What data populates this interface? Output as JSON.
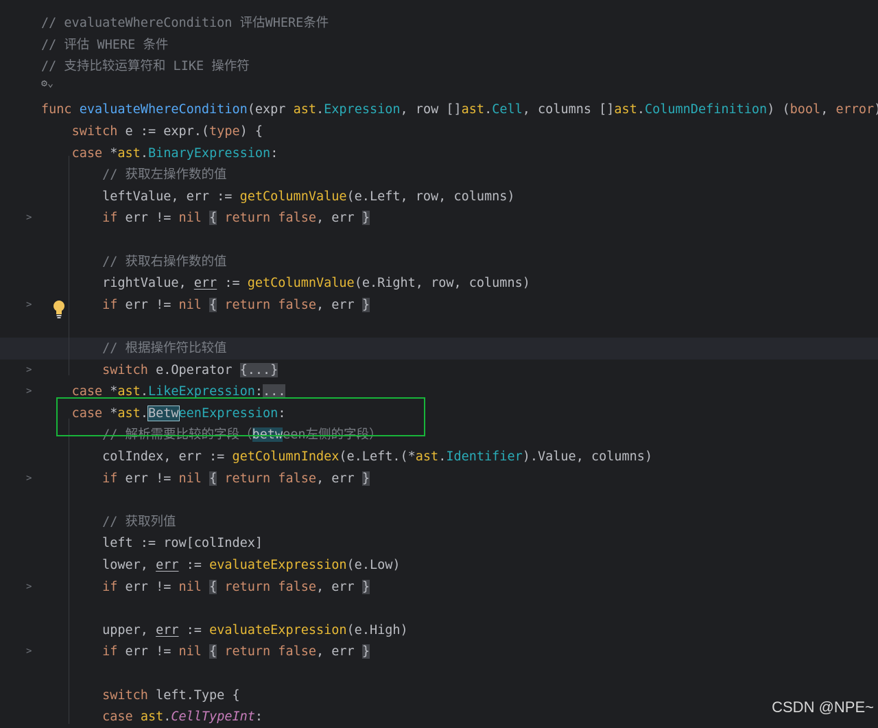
{
  "lines": [
    {
      "fold": false,
      "current": false,
      "tokens": [
        [
          "cmt",
          "// evaluateWhereCondition 评估WHERE条件"
        ]
      ]
    },
    {
      "fold": false,
      "current": false,
      "tokens": [
        [
          "cmt",
          "// 评估 WHERE 条件"
        ]
      ]
    },
    {
      "fold": false,
      "current": false,
      "tokens": [
        [
          "cmt",
          "// 支持比较运算符和 LIKE 操作符"
        ]
      ]
    },
    {
      "fold": false,
      "current": false,
      "tokens": []
    },
    {
      "fold": false,
      "current": false,
      "tokens": [
        [
          "kw",
          "func "
        ],
        [
          "fn",
          "evaluateWhereCondition"
        ],
        [
          "pl",
          "(expr "
        ],
        [
          "call",
          "ast"
        ],
        [
          "pl",
          "."
        ],
        [
          "typ",
          "Expression"
        ],
        [
          "pl",
          ", row []"
        ],
        [
          "call",
          "ast"
        ],
        [
          "pl",
          "."
        ],
        [
          "typ",
          "Cell"
        ],
        [
          "pl",
          ", columns []"
        ],
        [
          "call",
          "ast"
        ],
        [
          "pl",
          "."
        ],
        [
          "typ",
          "ColumnDefinition"
        ],
        [
          "pl",
          ") ("
        ],
        [
          "kw",
          "bool"
        ],
        [
          "pl",
          ", "
        ],
        [
          "kw",
          "error"
        ],
        [
          "pl",
          ")"
        ]
      ]
    },
    {
      "fold": false,
      "current": false,
      "tokens": [
        [
          "pl",
          "    "
        ],
        [
          "kw",
          "switch"
        ],
        [
          "pl",
          " e := expr.("
        ],
        [
          "kw",
          "type"
        ],
        [
          "pl",
          ") {"
        ]
      ]
    },
    {
      "fold": false,
      "current": false,
      "tokens": [
        [
          "pl",
          "    "
        ],
        [
          "kw",
          "case"
        ],
        [
          "pl",
          " *"
        ],
        [
          "call",
          "ast"
        ],
        [
          "pl",
          "."
        ],
        [
          "typ",
          "BinaryExpression"
        ],
        [
          "pl",
          ":"
        ]
      ]
    },
    {
      "fold": false,
      "current": false,
      "tokens": [
        [
          "pl",
          "        "
        ],
        [
          "cmt",
          "// 获取左操作数的值"
        ]
      ]
    },
    {
      "fold": false,
      "current": false,
      "tokens": [
        [
          "pl",
          "        leftValue, err := "
        ],
        [
          "call",
          "getColumnValue"
        ],
        [
          "pl",
          "(e.Left, row, columns)"
        ]
      ]
    },
    {
      "fold": true,
      "current": false,
      "tokens": [
        [
          "pl",
          "        "
        ],
        [
          "kw",
          "if"
        ],
        [
          "pl",
          " err != "
        ],
        [
          "kw",
          "nil"
        ],
        [
          "pl",
          " "
        ],
        [
          "brk",
          "{"
        ],
        [
          "pl",
          " "
        ],
        [
          "kw",
          "return false"
        ],
        [
          "pl",
          ", err "
        ],
        [
          "brk",
          "}"
        ]
      ]
    },
    {
      "fold": false,
      "current": false,
      "tokens": []
    },
    {
      "fold": false,
      "current": false,
      "tokens": [
        [
          "pl",
          "        "
        ],
        [
          "cmt",
          "// 获取右操作数的值"
        ]
      ]
    },
    {
      "fold": false,
      "current": false,
      "tokens": [
        [
          "pl",
          "        rightValue, "
        ],
        [
          "ul",
          "err"
        ],
        [
          "pl",
          " := "
        ],
        [
          "call",
          "getColumnValue"
        ],
        [
          "pl",
          "(e.Right, row, columns)"
        ]
      ]
    },
    {
      "fold": true,
      "current": false,
      "tokens": [
        [
          "pl",
          "        "
        ],
        [
          "kw",
          "if"
        ],
        [
          "pl",
          " err != "
        ],
        [
          "kw",
          "nil"
        ],
        [
          "pl",
          " "
        ],
        [
          "brk",
          "{"
        ],
        [
          "pl",
          " "
        ],
        [
          "kw",
          "return false"
        ],
        [
          "pl",
          ", err "
        ],
        [
          "brk",
          "}"
        ]
      ]
    },
    {
      "fold": false,
      "current": false,
      "tokens": []
    },
    {
      "fold": false,
      "current": true,
      "tokens": [
        [
          "pl",
          "        "
        ],
        [
          "cmt",
          "// 根据操作符比较值"
        ]
      ]
    },
    {
      "fold": true,
      "current": false,
      "tokens": [
        [
          "pl",
          "        "
        ],
        [
          "kw",
          "switch"
        ],
        [
          "pl",
          " e.Operator "
        ],
        [
          "brk",
          "{...}"
        ]
      ]
    },
    {
      "fold": true,
      "current": false,
      "tokens": [
        [
          "pl",
          "    "
        ],
        [
          "kw",
          "case"
        ],
        [
          "pl",
          " *"
        ],
        [
          "call",
          "ast"
        ],
        [
          "pl",
          "."
        ],
        [
          "typ",
          "LikeExpression"
        ],
        [
          "pl",
          ":"
        ],
        [
          "brk",
          "..."
        ]
      ]
    },
    {
      "fold": false,
      "current": false,
      "tokens": [
        [
          "pl",
          "    "
        ],
        [
          "kw",
          "case"
        ],
        [
          "pl",
          " *"
        ],
        [
          "call",
          "ast"
        ],
        [
          "pl",
          "."
        ],
        [
          "hlb",
          "Betw"
        ],
        [
          "typ",
          "eenExpression"
        ],
        [
          "pl",
          ":"
        ]
      ]
    },
    {
      "fold": false,
      "current": false,
      "tokens": [
        [
          "pl",
          "        "
        ],
        [
          "cmt",
          "// 解析需要比较的字段（"
        ],
        [
          "hl",
          "betw"
        ],
        [
          "cmt",
          "een左侧的字段）"
        ]
      ]
    },
    {
      "fold": false,
      "current": false,
      "tokens": [
        [
          "pl",
          "        colIndex, err := "
        ],
        [
          "call",
          "getColumnIndex"
        ],
        [
          "pl",
          "(e.Left.(*"
        ],
        [
          "call",
          "ast"
        ],
        [
          "pl",
          "."
        ],
        [
          "typ",
          "Identifier"
        ],
        [
          "pl",
          ").Value, columns)"
        ]
      ]
    },
    {
      "fold": true,
      "current": false,
      "tokens": [
        [
          "pl",
          "        "
        ],
        [
          "kw",
          "if"
        ],
        [
          "pl",
          " err != "
        ],
        [
          "kw",
          "nil"
        ],
        [
          "pl",
          " "
        ],
        [
          "brk",
          "{"
        ],
        [
          "pl",
          " "
        ],
        [
          "kw",
          "return false"
        ],
        [
          "pl",
          ", err "
        ],
        [
          "brk",
          "}"
        ]
      ]
    },
    {
      "fold": false,
      "current": false,
      "tokens": []
    },
    {
      "fold": false,
      "current": false,
      "tokens": [
        [
          "pl",
          "        "
        ],
        [
          "cmt",
          "// 获取列值"
        ]
      ]
    },
    {
      "fold": false,
      "current": false,
      "tokens": [
        [
          "pl",
          "        left := row[colIndex]"
        ]
      ]
    },
    {
      "fold": false,
      "current": false,
      "tokens": [
        [
          "pl",
          "        lower, "
        ],
        [
          "ul",
          "err"
        ],
        [
          "pl",
          " := "
        ],
        [
          "call",
          "evaluateExpression"
        ],
        [
          "pl",
          "(e.Low)"
        ]
      ]
    },
    {
      "fold": true,
      "current": false,
      "tokens": [
        [
          "pl",
          "        "
        ],
        [
          "kw",
          "if"
        ],
        [
          "pl",
          " err != "
        ],
        [
          "kw",
          "nil"
        ],
        [
          "pl",
          " "
        ],
        [
          "brk",
          "{"
        ],
        [
          "pl",
          " "
        ],
        [
          "kw",
          "return false"
        ],
        [
          "pl",
          ", err "
        ],
        [
          "brk",
          "}"
        ]
      ]
    },
    {
      "fold": false,
      "current": false,
      "tokens": []
    },
    {
      "fold": false,
      "current": false,
      "tokens": [
        [
          "pl",
          "        upper, "
        ],
        [
          "ul",
          "err"
        ],
        [
          "pl",
          " := "
        ],
        [
          "call",
          "evaluateExpression"
        ],
        [
          "pl",
          "(e.High)"
        ]
      ]
    },
    {
      "fold": true,
      "current": false,
      "tokens": [
        [
          "pl",
          "        "
        ],
        [
          "kw",
          "if"
        ],
        [
          "pl",
          " err != "
        ],
        [
          "kw",
          "nil"
        ],
        [
          "pl",
          " "
        ],
        [
          "brk",
          "{"
        ],
        [
          "pl",
          " "
        ],
        [
          "kw",
          "return false"
        ],
        [
          "pl",
          ", err "
        ],
        [
          "brk",
          "}"
        ]
      ]
    },
    {
      "fold": false,
      "current": false,
      "tokens": []
    },
    {
      "fold": false,
      "current": false,
      "tokens": [
        [
          "pl",
          "        "
        ],
        [
          "kw",
          "switch"
        ],
        [
          "pl",
          " left.Type {"
        ]
      ]
    },
    {
      "fold": false,
      "current": false,
      "tokens": [
        [
          "pl",
          "        "
        ],
        [
          "kw",
          "case"
        ],
        [
          "pl",
          " "
        ],
        [
          "call",
          "ast"
        ],
        [
          "pl",
          "."
        ],
        [
          "ityp",
          "CellTypeInt"
        ],
        [
          "pl",
          ":"
        ]
      ]
    }
  ],
  "gutter": {
    "fold_glyph": ">",
    "generate_glyph": "⚙⌄"
  },
  "watermark": "CSDN @NPE~",
  "colors": {
    "background": "#1e1f22",
    "keyword": "#cf8e6d",
    "function": "#56a8f5",
    "type": "#2aacb8",
    "comment": "#7a7e85",
    "highlight_box": "#18b53a"
  }
}
